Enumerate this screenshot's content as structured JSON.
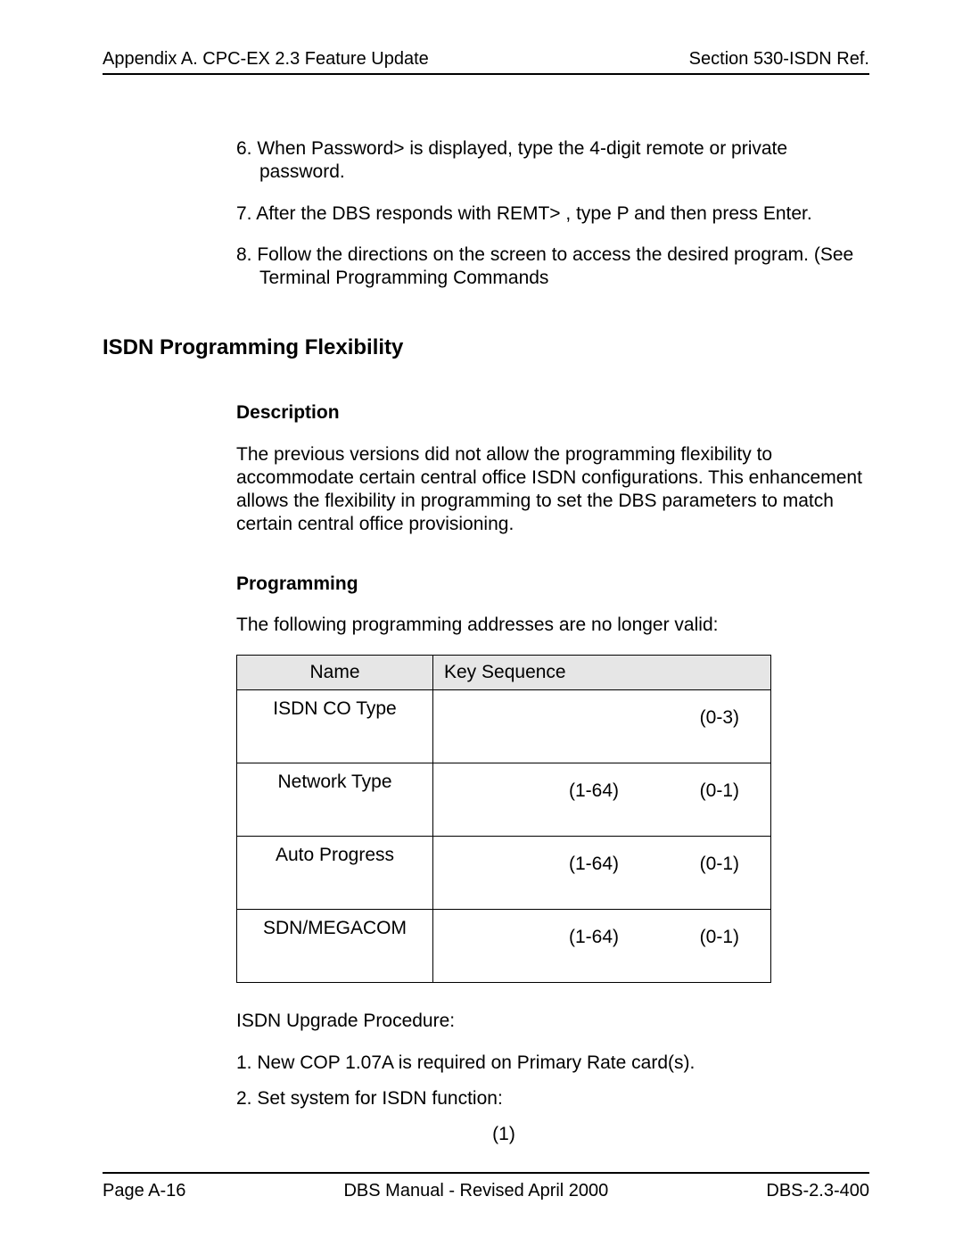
{
  "header": {
    "left": "Appendix A. CPC-EX 2.3 Feature Update",
    "right": "Section 530-ISDN Ref."
  },
  "steps_top": {
    "s6": "6. When Password> is displayed, type the 4-digit remote or private password.",
    "s7": "7. After the DBS responds with REMT> , type P and then press Enter.",
    "s8": "8. Follow the directions on the screen to access the desired program. (See Terminal Programming Commands"
  },
  "h2": "ISDN Programming Flexibility",
  "description": {
    "heading": "Description",
    "body": "The previous versions did not allow the programming flexibility to accommodate certain central office ISDN configurations. This enhancement allows the flexibility in programming to set the DBS parameters to match certain central office provisioning."
  },
  "programming": {
    "heading": "Programming",
    "intro": "The following programming addresses are no longer valid:",
    "table": {
      "head_name": "Name",
      "head_seq": "Key Sequence",
      "rows": [
        {
          "name": "ISDN CO Type",
          "mid": "",
          "right": "(0-3)"
        },
        {
          "name": "Network Type",
          "mid": "(1-64)",
          "right": "(0-1)"
        },
        {
          "name": "Auto Progress",
          "mid": "(1-64)",
          "right": "(0-1)"
        },
        {
          "name": "SDN/MEGACOM",
          "mid": "(1-64)",
          "right": "(0-1)"
        }
      ]
    }
  },
  "upgrade": {
    "intro": "ISDN Upgrade Procedure:",
    "s1": "1. New COP 1.07A is required on Primary Rate card(s).",
    "s2": "2. Set system for ISDN function:",
    "center": "(1)"
  },
  "footer": {
    "left": "Page A-16",
    "center": "DBS Manual - Revised April 2000",
    "right": "DBS-2.3-400"
  }
}
